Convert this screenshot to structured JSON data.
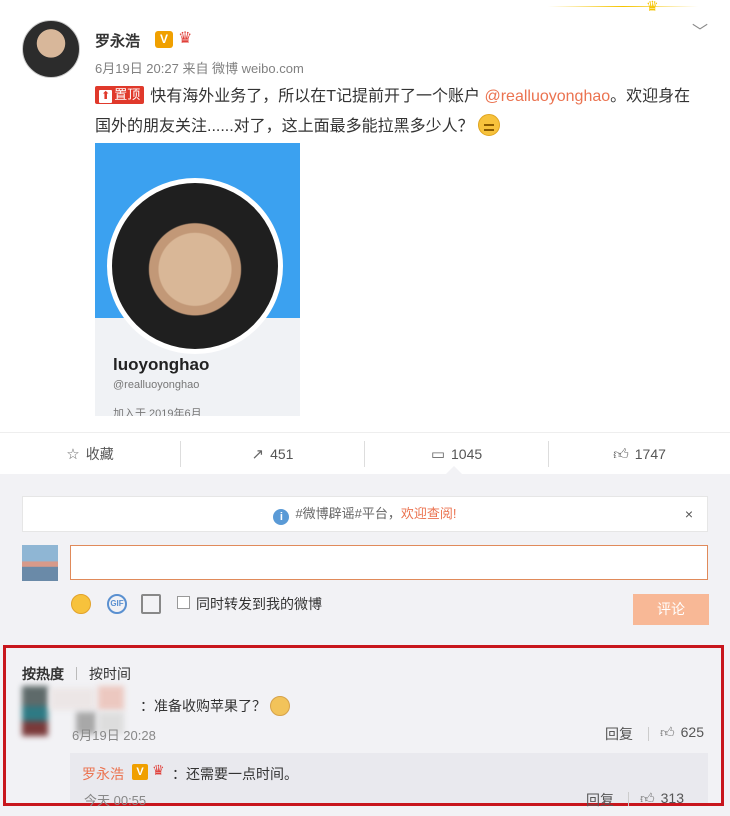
{
  "post": {
    "author": "罗永浩",
    "verified_badge": "V",
    "meta": "6月19日 20:27 来自 微博 weibo.com",
    "pin_label": "置顶",
    "pin_arrow": "⬆",
    "text_before_mention": "快有海外业务了，所以在T记提前开了一个账户 ",
    "mention": "@realluoyonghao",
    "text_after_mention": "。欢迎身在国外的朋友关注......对了，这上面最多能拉黑多少人？",
    "emoji": "smirk-face",
    "card": {
      "name": "luoyonghao",
      "handle": "@realluoyonghao",
      "joined": "加入于 2019年6月"
    }
  },
  "actions": {
    "favorite_label": "收藏",
    "repost_count": "451",
    "comment_count": "1045",
    "like_count": "1747"
  },
  "notice": {
    "text_prefix": "#微博辟谣#平台，",
    "link": "欢迎查阅!",
    "close": "×"
  },
  "composer": {
    "placeholder": "",
    "gif_label": "GIF",
    "repost_label": "同时转发到我的微博",
    "submit_label": "评论"
  },
  "comments": {
    "sort_hot": "按热度",
    "sort_time": "按时间",
    "items": [
      {
        "text": "：准备收购苹果了？",
        "emoji": "doge",
        "time": "6月19日 20:28",
        "reply_label": "回复",
        "likes": "625",
        "sub_reply": {
          "author": "罗永浩",
          "text": "：还需要一点时间。",
          "time": "今天 00:55",
          "reply_label": "回复",
          "likes": "313"
        }
      }
    ]
  },
  "colors": {
    "accent": "#eb7350",
    "highlight_border": "#c8161d",
    "pin_red": "#e0392b"
  }
}
